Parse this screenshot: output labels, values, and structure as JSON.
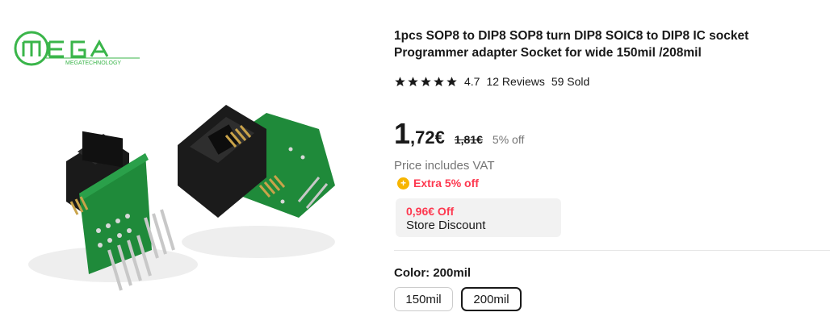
{
  "brand_logo": {
    "text": "MEGA",
    "subtext": "MEGATECHNOLOGY"
  },
  "product": {
    "title": "1pcs SOP8 to DIP8 SOP8 turn DIP8 SOIC8 to DIP8 IC socket Programmer adapter Socket for wide 150mil /208mil",
    "rating": "4.7",
    "reviews": "12 Reviews",
    "sold": "59 Sold",
    "stars": 5
  },
  "price": {
    "integer": "1",
    "decimal": ",72€",
    "original": "1,81€",
    "discount": "5% off",
    "vat_note": "Price includes VAT",
    "extra_off": "Extra 5% off"
  },
  "store_discount": {
    "amount": "0,96€ Off",
    "label": "Store Discount"
  },
  "color": {
    "label": "Color: 200mil",
    "options": [
      {
        "label": "150mil",
        "selected": false
      },
      {
        "label": "200mil",
        "selected": true
      }
    ]
  },
  "colors": {
    "brand_green": "#3ab54a",
    "sale_red": "#fd384f",
    "coin_yellow": "#f7b500",
    "text_gray": "#757575"
  }
}
